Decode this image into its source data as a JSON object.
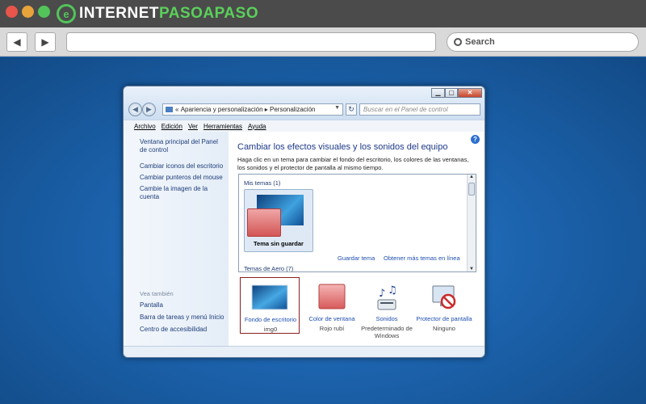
{
  "browser": {
    "brand_prefix": "INTERNET",
    "brand_suffix": "PASOAPASO",
    "logo_letter": "e",
    "back_symbol": "◀",
    "forward_symbol": "▶",
    "search_placeholder": "Search",
    "traffic_colors": [
      "#e8554b",
      "#e9a33b",
      "#52c45a"
    ]
  },
  "window": {
    "breadcrumb": [
      "«",
      "Apariencia y personalización",
      "Personalización"
    ],
    "search_placeholder": "Buscar en el Panel de control",
    "menu": [
      "Archivo",
      "Edición",
      "Ver",
      "Herramientas",
      "Ayuda"
    ],
    "sidebar": {
      "links": [
        "Ventana principal del Panel de control",
        "Cambiar iconos del escritorio",
        "Cambiar punteros del mouse",
        "Cambie la imagen de la cuenta"
      ],
      "see_also_title": "Vea también",
      "see_also": [
        "Pantalla",
        "Barra de tareas y menú Inicio",
        "Centro de accesibilidad"
      ]
    },
    "heading": "Cambiar los efectos visuales y los sonidos del equipo",
    "description": "Haga clic en un tema para cambiar el fondo del escritorio, los colores de las ventanas, los sonidos y el protector de pantalla al mismo tiempo.",
    "themes": {
      "my_themes_title": "Mis temas (1)",
      "unsaved_theme": "Tema sin guardar",
      "save_link": "Guardar tema",
      "more_link": "Obtener más temas en línea",
      "aero_title": "Temas de Aero (7)"
    },
    "options": [
      {
        "label": "Fondo de escritorio",
        "sub": "img0",
        "icon": "desktop-background-icon"
      },
      {
        "label": "Color de ventana",
        "sub": "Rojo rubí",
        "icon": "window-color-icon"
      },
      {
        "label": "Sonidos",
        "sub": "Predeterminado de Windows",
        "icon": "sounds-icon"
      },
      {
        "label": "Protector de pantalla",
        "sub": "Ninguno",
        "icon": "screensaver-icon"
      }
    ],
    "help_symbol": "?"
  }
}
